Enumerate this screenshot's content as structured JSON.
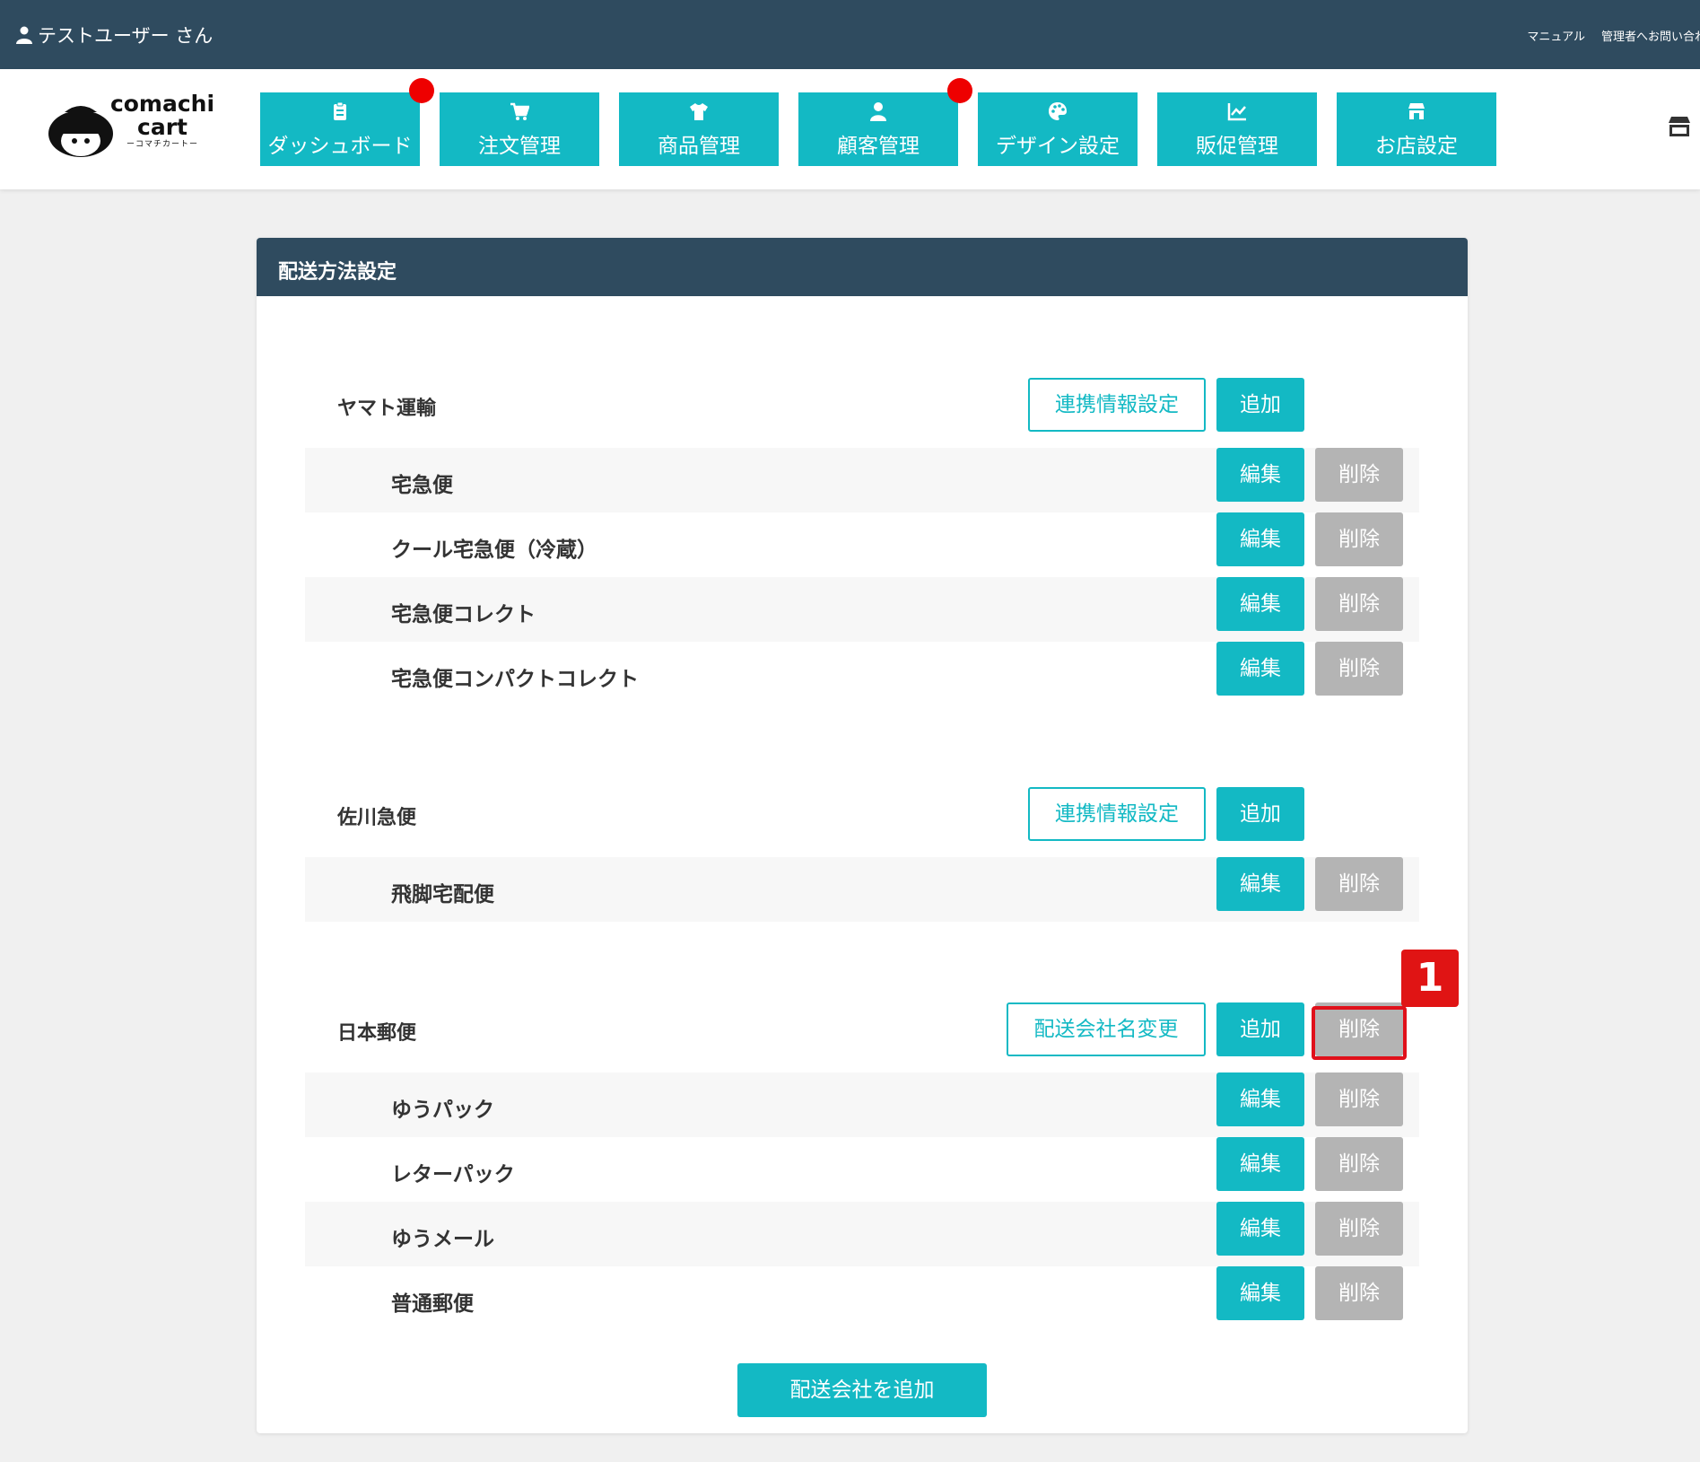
{
  "topbar": {
    "user_label": "テストユーザー さん",
    "manual_link": "マニュアル",
    "contact_link": "管理者へお問い合わせ"
  },
  "logo": {
    "brand_line1": "comachi",
    "brand_line2": "cart",
    "brand_sub": "ーコマチカートー"
  },
  "nav": [
    {
      "label": "ダッシュボード",
      "icon": "clipboard-icon",
      "dot": true
    },
    {
      "label": "注文管理",
      "icon": "cart-icon",
      "dot": false
    },
    {
      "label": "商品管理",
      "icon": "shirt-icon",
      "dot": false
    },
    {
      "label": "顧客管理",
      "icon": "person-icon",
      "dot": true
    },
    {
      "label": "デザイン設定",
      "icon": "palette-icon",
      "dot": false
    },
    {
      "label": "販促管理",
      "icon": "chart-line-icon",
      "dot": false
    },
    {
      "label": "お店設定",
      "icon": "store-icon",
      "dot": false
    }
  ],
  "panel": {
    "title": "配送方法設定"
  },
  "buttons": {
    "link_settings": "連携情報設定",
    "add": "追加",
    "edit": "編集",
    "delete": "削除",
    "rename_company": "配送会社名変更",
    "add_company": "配送会社を追加"
  },
  "sections": [
    {
      "name": "ヤマト運輸",
      "methods": [
        "宅急便",
        "クール宅急便（冷蔵）",
        "宅急便コレクト",
        "宅急便コンパクトコレクト"
      ]
    },
    {
      "name": "佐川急便",
      "methods": [
        "飛脚宅配便"
      ]
    },
    {
      "name": "日本郵便",
      "methods": [
        "ゆうパック",
        "レターパック",
        "ゆうメール",
        "普通郵便"
      ]
    }
  ],
  "annotation": {
    "step_number": "1"
  },
  "colors": {
    "header_bg": "#2f4b5f",
    "accent": "#13b9c4",
    "delete_gray": "#b4b4b4",
    "notify_red": "#ee0000",
    "annotation_red": "#e01414"
  }
}
